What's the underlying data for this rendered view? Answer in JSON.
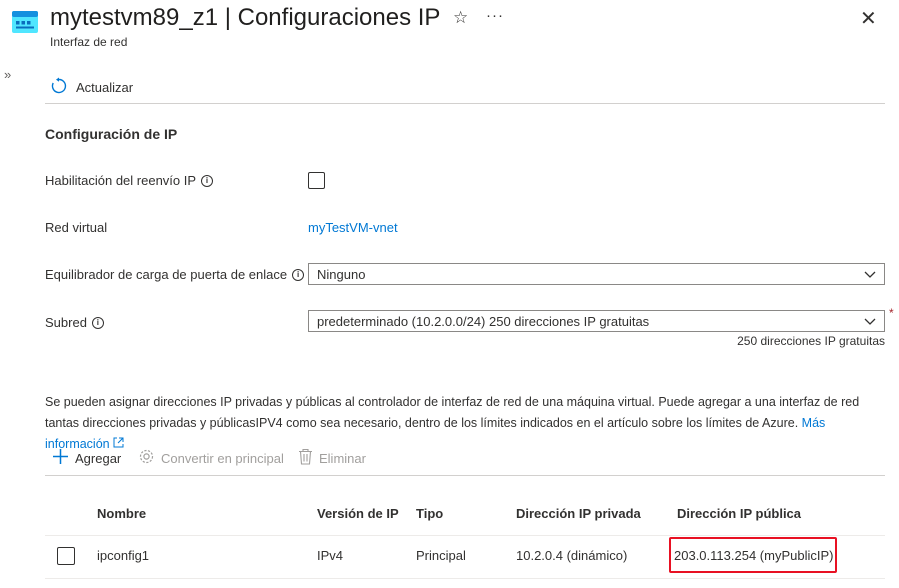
{
  "header": {
    "title": "mytestvm89_z1 | Configuraciones IP",
    "subtitle": "Interfaz de red",
    "more_label": "···",
    "close_label": "✕",
    "star_label": "☆",
    "expand_label": "»"
  },
  "toolbar": {
    "refresh_label": "Actualizar"
  },
  "section": {
    "title": "Configuración de IP"
  },
  "form": {
    "forwarding_label": "Habilitación del reenvío IP",
    "vnet_label": "Red virtual",
    "vnet_value": "myTestVM-vnet",
    "gateway_lb_label": "Equilibrador de carga de puerta de enlace",
    "gateway_lb_value": "Ninguno",
    "subnet_label": "Subred",
    "subnet_value": "predeterminado (10.2.0.0/24) 250 direcciones IP gratuitas",
    "subnet_note": "250 direcciones IP gratuitas",
    "required_mark": "*"
  },
  "info_text": {
    "text": "Se pueden asignar direcciones IP privadas y públicas al controlador de interfaz de red de una máquina virtual. Puede agregar a una interfaz de red tantas direcciones privadas y públicasIPV4 como sea necesario, dentro de los límites indicados en el artículo sobre los límites de Azure.",
    "link": "Más información"
  },
  "actions": {
    "add": "Agregar",
    "make_primary": "Convertir en principal",
    "delete": "Eliminar"
  },
  "table": {
    "columns": [
      "Nombre",
      "Versión de IP",
      "Tipo",
      "Dirección IP privada",
      "Dirección IP pública"
    ],
    "rows": [
      {
        "name": "ipconfig1",
        "version": "IPv4",
        "type": "Principal",
        "private_ip": "10.2.0.4 (dinámico)",
        "public_ip": "203.0.113.254",
        "public_ip_name": "(myPublicIP)"
      }
    ]
  },
  "colors": {
    "link": "#0078d4",
    "highlight": "#e81123",
    "accent_icon": "#50e6ff"
  }
}
